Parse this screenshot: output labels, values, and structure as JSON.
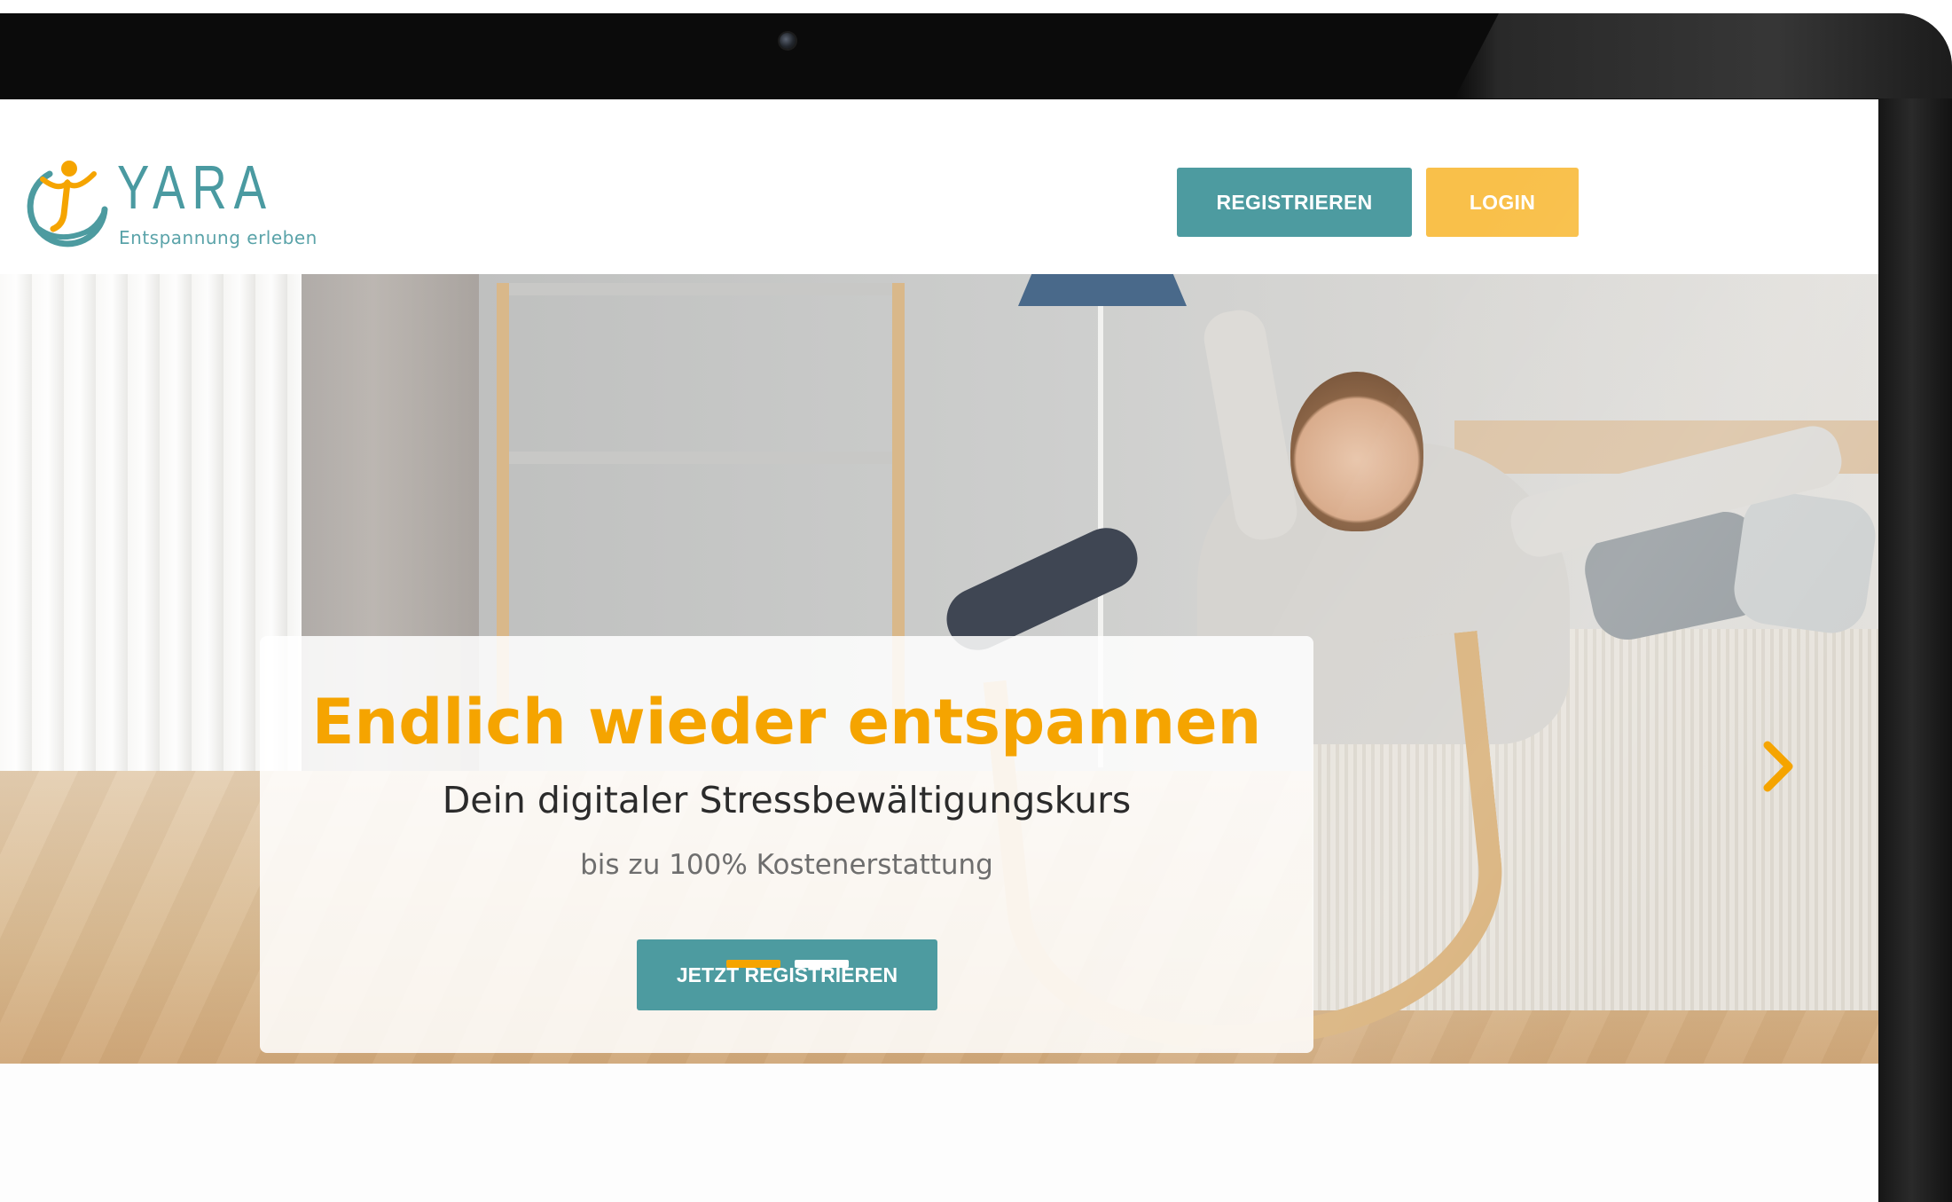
{
  "brand": {
    "name": "YARA",
    "tagline": "Entspannung erleben",
    "colors": {
      "teal": "#4d9ba0",
      "yellow": "#f9c04a",
      "orange": "#f5a400"
    }
  },
  "header": {
    "register_label": "REGISTRIEREN",
    "login_label": "LOGIN"
  },
  "hero": {
    "title": "Endlich wieder entspannen",
    "subtitle": "Dein digitaler Stressbewältigungskurs",
    "refund": "bis zu 100% Kostenerstattung",
    "cta_label": "JETZT REGISTRIEREN",
    "next_icon": "chevron-right-icon",
    "slide_count": 2,
    "active_slide": 1
  }
}
